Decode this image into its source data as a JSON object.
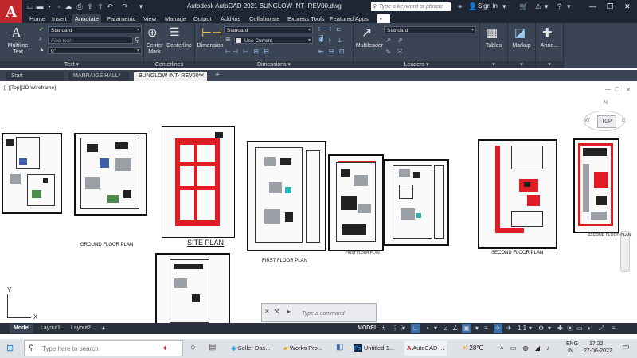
{
  "app": {
    "logo": "A",
    "title": "Autodesk AutoCAD 2021    BUNGLOW INT- REV00.dwg"
  },
  "titlebar": {
    "search_placeholder": "Type a keyword or phrase",
    "signin_label": "Sign In"
  },
  "ribbon_tabs": [
    "Home",
    "Insert",
    "Annotate",
    "Parametric",
    "View",
    "Manage",
    "Output",
    "Add-ins",
    "Collaborate",
    "Express Tools",
    "Featured Apps"
  ],
  "active_ribbon_tab": "Annotate",
  "panels": {
    "text": {
      "title": "Text",
      "multiline_label": "Multiline Text",
      "style_value": "Standard",
      "find_placeholder": "Find text",
      "height_value": "0\""
    },
    "centerlines": {
      "title": "Centerlines",
      "center_mark_label": "Center Mark",
      "centerline_label": "Centerline"
    },
    "dimensions": {
      "title": "Dimensions",
      "dimension_label": "Dimension",
      "style_value": "Standard",
      "layer_value": "Use Current"
    },
    "leaders": {
      "title": "Leaders",
      "multileader_label": "Multileader",
      "style_value": "Standard"
    },
    "tables": {
      "label": "Tables"
    },
    "markup": {
      "label": "Markup"
    },
    "annotation": {
      "label": "Anno..."
    }
  },
  "doc_tabs": [
    {
      "label": "Start"
    },
    {
      "label": "MARRAIGE HALL*"
    },
    {
      "label": "BUNGLOW INT- REV00*"
    }
  ],
  "viewport_label": "[–][Top][2D Wireframe]",
  "viewcube": {
    "top": "TOP",
    "n": "N",
    "w": "W",
    "e": "E"
  },
  "drawing_captions": {
    "ground": "GROUND FLOOR PLAN",
    "site": "SITE PLAN",
    "first": "FIRST FLOOR PLAN",
    "first_small": "FIRST FLOOR PLAN",
    "second": "SECOND FLOOR PLAN",
    "second_small": "SECOND FLOOR PLAN"
  },
  "ucs": {
    "y": "Y",
    "x": "X"
  },
  "command_placeholder": "Type a command",
  "layout_tabs": [
    "Model",
    "Layout1",
    "Layout2"
  ],
  "status": {
    "model_label": "MODEL",
    "scale": "1:1"
  },
  "taskbar": {
    "search_placeholder": "Type here to search",
    "apps": [
      "Seller Das...",
      "Works Pro...",
      "Untitled-1...",
      "AutoCAD ..."
    ],
    "weather": "28°C",
    "lang_top": "ENG",
    "lang_bottom": "IN",
    "time": "17:22",
    "date": "27-06-2022"
  },
  "colors": {
    "accent_red": "#e01b24",
    "ribbon": "#3b4455",
    "titlebar": "#1f2633"
  }
}
